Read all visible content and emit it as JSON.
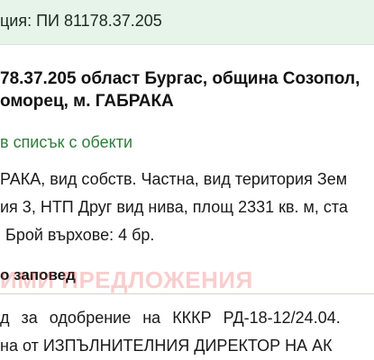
{
  "header": {
    "text": "ция: ПИ 81178.37.205"
  },
  "property": {
    "title_line1": "78.37.205 област Бургас, община Созопол,",
    "title_line2": "оморец, м. ГАБРАКА"
  },
  "back_link": {
    "label": "в списък с обекти"
  },
  "details": {
    "line1": "РАКА, вид собств. Частна, вид територия Зем",
    "line2": "ия 3, НТП Друг вид нива, площ 2331 кв. м, ста",
    "line3": "Брой върхове: 4 бр."
  },
  "order_section": {
    "heading": "о заповед",
    "watermark": "ИМИ ПРЕДЛОЖЕНИЯ",
    "line1": "д за одобрение на КККР РД-18-12/24.04.",
    "line2": "на от ИЗПЪЛНИТЕЛНИЯ ДИРЕКТОР НА АК"
  }
}
